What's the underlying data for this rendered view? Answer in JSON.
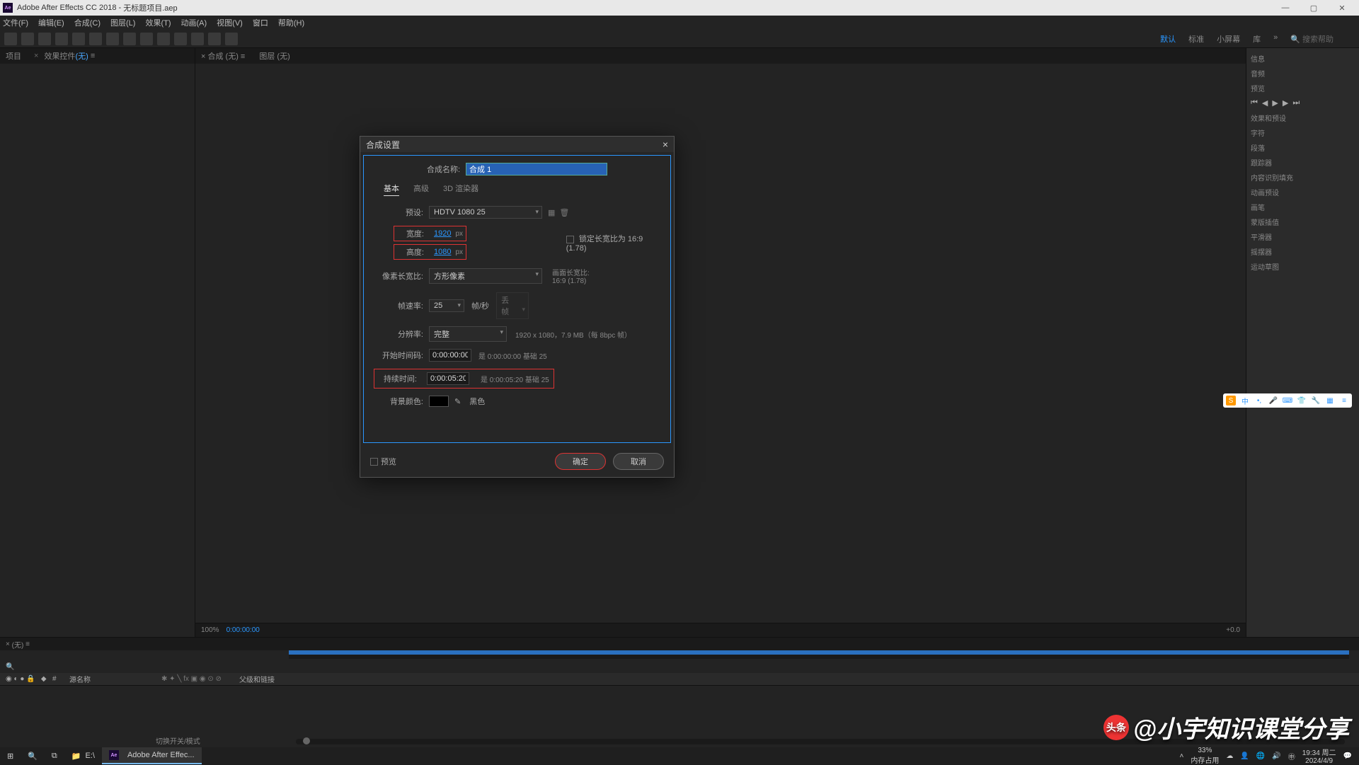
{
  "titlebar": {
    "app": "Adobe After Effects CC 2018",
    "project": "无标题项目.aep"
  },
  "menus": [
    "文件(F)",
    "编辑(E)",
    "合成(C)",
    "图层(L)",
    "效果(T)",
    "动画(A)",
    "视图(V)",
    "窗口",
    "帮助(H)"
  ],
  "workspaces": {
    "active": "默认",
    "others": [
      "标准",
      "小屏幕",
      "库"
    ]
  },
  "leftTabs": {
    "project": "项目",
    "effects_prefix": "效果控件 ",
    "effects_hl": "(无)"
  },
  "centerTabs": {
    "comp_prefix": "合成 ",
    "comp_hl": "(无)",
    "layer": "图层 (无)"
  },
  "rightItems": [
    "信息",
    "音频",
    "预览",
    "效果和预设",
    "字符",
    "段落",
    "跟踪器",
    "内容识别填充",
    "动画预设",
    "画笔",
    "蒙版插值",
    "平滑器",
    "摇摆器",
    "运动草图"
  ],
  "timeline": {
    "tab": "(无)",
    "col_source": "源名称",
    "col_parent": "父级和链接",
    "toggle": "切换开关/模式"
  },
  "viewer": {
    "zoom": "100%",
    "time": "0:00:00:00",
    "camera": "+0.0"
  },
  "dialog": {
    "title": "合成设置",
    "nameLabel": "合成名称:",
    "nameValue": "合成 1",
    "tabs": [
      "基本",
      "高级",
      "3D 渲染器"
    ],
    "presetLabel": "预设:",
    "preset": "HDTV 1080 25",
    "widthLabel": "宽度:",
    "width": "1920",
    "heightLabel": "高度:",
    "height": "1080",
    "px": "px",
    "lockAspect": "锁定长宽比为 16:9 (1.78)",
    "pixelAspectLabel": "像素长宽比:",
    "pixelAspect": "方形像素",
    "frameAspect": "画面长宽比:",
    "frameAspectVal": "16:9 (1.78)",
    "fpsLabel": "帧速率:",
    "fps": "25",
    "fpsUnit": "帧/秒",
    "fpsDrop": "丢帧",
    "resLabel": "分辨率:",
    "res": "完整",
    "resInfo": "1920 x 1080，7.9 MB（每 8bpc 帧）",
    "startLabel": "开始时间码:",
    "start": "0:00:00:00",
    "startInfo": "是 0:00:00:00 基础 25",
    "durLabel": "持续时间:",
    "dur": "0:00:05:20",
    "durInfo": "是 0:00:05:20 基础 25",
    "bgLabel": "背景颜色:",
    "bgName": "黑色",
    "preview": "预览",
    "ok": "确定",
    "cancel": "取消"
  },
  "taskbar": {
    "explorer": "E:\\",
    "ae": "Adobe After Effec...",
    "memPct": "33%",
    "memLbl": "内存占用",
    "time": "19:34 周二",
    "date": "2024/4/9"
  },
  "watermark": {
    "prefix": "头条",
    "author": "@小宇知识课堂分享"
  }
}
